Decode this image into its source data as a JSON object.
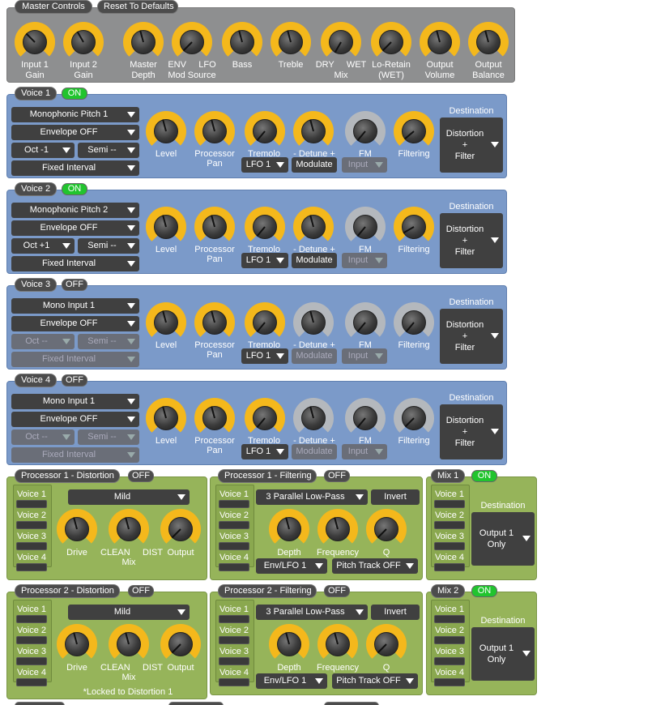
{
  "master": {
    "title": "Master Controls",
    "reset": "Reset To Defaults",
    "knobs": [
      {
        "l1": "Input 1",
        "l2": "Gain"
      },
      {
        "l1": "Input 2",
        "l2": "Gain"
      },
      {
        "l1": "Master",
        "l2": "Depth"
      },
      {
        "l1": "ENV     LFO",
        "l2": "Mod Source"
      },
      {
        "l1": "Bass",
        "l2": ""
      },
      {
        "l1": "Treble",
        "l2": ""
      },
      {
        "l1": "DRY     WET",
        "l2": "Mix"
      },
      {
        "l1": "Lo-Retain",
        "l2": "(WET)"
      },
      {
        "l1": "Output",
        "l2": "Volume"
      },
      {
        "l1": "Output",
        "l2": "Balance"
      }
    ]
  },
  "voice_labels": {
    "level": "Level",
    "pan1": "Processor",
    "pan2": "Pan",
    "tremolo": "Tremolo",
    "detune": "- Detune +",
    "fm": "FM",
    "filtering": "Filtering",
    "destination": "Destination"
  },
  "voices": [
    {
      "title": "Voice 1",
      "state": "ON",
      "mode": "Monophonic Pitch 1",
      "env": "Envelope OFF",
      "oct": "Oct -1",
      "semi": "Semi --",
      "interval": "Fixed Interval",
      "lfo": "LFO 1",
      "modulate": "Modulate",
      "input": "Input",
      "dest1": "Distortion",
      "dest2": "+",
      "dest3": "Filter"
    },
    {
      "title": "Voice 2",
      "state": "ON",
      "mode": "Monophonic Pitch 2",
      "env": "Envelope OFF",
      "oct": "Oct +1",
      "semi": "Semi --",
      "interval": "Fixed Interval",
      "lfo": "LFO 1",
      "modulate": "Modulate",
      "input": "Input",
      "dest1": "Distortion",
      "dest2": "+",
      "dest3": "Filter"
    },
    {
      "title": "Voice 3",
      "state": "OFF",
      "mode": "Mono Input 1",
      "env": "Envelope OFF",
      "oct": "Oct --",
      "semi": "Semi --",
      "interval": "Fixed Interval",
      "lfo": "LFO 1",
      "modulate": "Modulate",
      "input": "Input",
      "dest1": "Distortion",
      "dest2": "+",
      "dest3": "Filter"
    },
    {
      "title": "Voice 4",
      "state": "OFF",
      "mode": "Mono Input 1",
      "env": "Envelope OFF",
      "oct": "Oct --",
      "semi": "Semi --",
      "interval": "Fixed Interval",
      "lfo": "LFO 1",
      "modulate": "Modulate",
      "input": "Input",
      "dest1": "Distortion",
      "dest2": "+",
      "dest3": "Filter"
    }
  ],
  "voice_names": [
    "Voice 1",
    "Voice 2",
    "Voice 3",
    "Voice 4"
  ],
  "dist": [
    {
      "title": "Processor 1 - Distortion",
      "state": "OFF",
      "mode": "Mild",
      "drive": "Drive",
      "mix1": "CLEAN     DIST",
      "mix2": "Mix",
      "output": "Output",
      "note": ""
    },
    {
      "title": "Processor 2 - Distortion",
      "state": "OFF",
      "mode": "Mild",
      "drive": "Drive",
      "mix1": "CLEAN     DIST",
      "mix2": "Mix",
      "output": "Output",
      "note": "*Locked to Distortion 1"
    }
  ],
  "filt": [
    {
      "title": "Processor 1 - Filtering",
      "state": "OFF",
      "mode": "3 Parallel Low-Pass",
      "invert": "Invert",
      "depth": "Depth",
      "freq": "Frequency",
      "q": "Q",
      "env": "Env/LFO 1",
      "pitch": "Pitch Track OFF"
    },
    {
      "title": "Processor 2 - Filtering",
      "state": "OFF",
      "mode": "3 Parallel Low-Pass",
      "invert": "Invert",
      "depth": "Depth",
      "freq": "Frequency",
      "q": "Q",
      "env": "Env/LFO 1",
      "pitch": "Pitch Track OFF"
    }
  ],
  "mix": [
    {
      "title": "Mix 1",
      "state": "ON",
      "destination": "Destination",
      "out1": "Output 1",
      "out2": "Only"
    },
    {
      "title": "Mix 2",
      "state": "ON",
      "destination": "Destination",
      "out1": "Output 1",
      "out2": "Only"
    }
  ],
  "colors": {
    "knob_active": "#f4b81c",
    "knob_inactive": "#b4b8bd",
    "on": "#21c42e",
    "panel_voice": "#7b9ac9",
    "panel_green": "#96b45a",
    "panel_master": "#8e8f90"
  }
}
